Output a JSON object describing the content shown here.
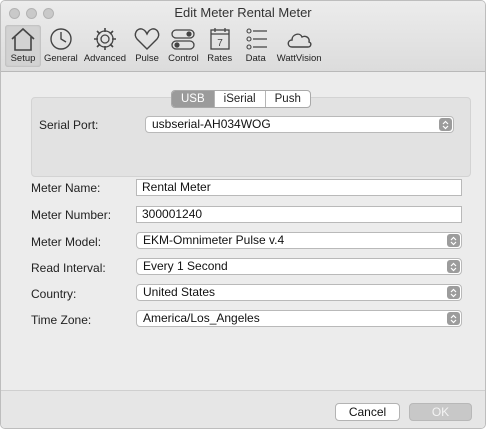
{
  "window": {
    "title": "Edit Meter Rental Meter"
  },
  "toolbar": {
    "items": [
      {
        "label": "Setup",
        "icon": "home-icon"
      },
      {
        "label": "General",
        "icon": "clock-icon"
      },
      {
        "label": "Advanced",
        "icon": "gear-icon"
      },
      {
        "label": "Pulse",
        "icon": "heart-icon"
      },
      {
        "label": "Control",
        "icon": "toggles-icon"
      },
      {
        "label": "Rates",
        "icon": "calendar-icon",
        "calendar_day": "7"
      },
      {
        "label": "Data",
        "icon": "list-icon"
      },
      {
        "label": "WattVision",
        "icon": "cloud-icon"
      }
    ],
    "active": "Setup"
  },
  "connection": {
    "tabs": [
      "USB",
      "iSerial",
      "Push"
    ],
    "selected_tab": "USB",
    "serial_port_label": "Serial Port:",
    "serial_port_value": "usbserial-AH034WOG"
  },
  "form": {
    "meter_name_label": "Meter Name:",
    "meter_name_value": "Rental Meter",
    "meter_number_label": "Meter Number:",
    "meter_number_value": "300001240",
    "meter_model_label": "Meter Model:",
    "meter_model_value": "EKM-Omnimeter Pulse v.4",
    "read_interval_label": "Read Interval:",
    "read_interval_value": "Every 1 Second",
    "country_label": "Country:",
    "country_value": "United States",
    "time_zone_label": "Time Zone:",
    "time_zone_value": "America/Los_Angeles"
  },
  "buttons": {
    "cancel": "Cancel",
    "ok": "OK"
  },
  "colors": {
    "active_segment": "#9b9b9b",
    "window_bg": "#ececec",
    "disabled_button": "#c8c8c8"
  }
}
